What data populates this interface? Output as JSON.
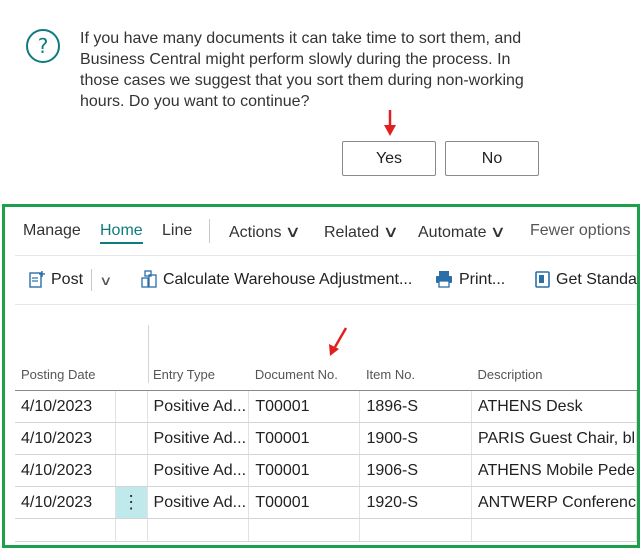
{
  "dialog": {
    "message": "If you have many documents it can take time to sort them, and Business Central might perform slowly during the process. In those cases we suggest that you sort them during non-working hours. Do you want to continue?",
    "icon": "question-icon",
    "yes_label": "Yes",
    "no_label": "No"
  },
  "menu": {
    "manage": "Manage",
    "home": "Home",
    "line": "Line",
    "actions": "Actions",
    "related": "Related",
    "automate": "Automate",
    "fewer_options": "Fewer options"
  },
  "toolbar": {
    "post": "Post",
    "calc": "Calculate Warehouse Adjustment...",
    "print": "Print...",
    "get_standard": "Get Standar"
  },
  "table": {
    "headers": [
      "Posting Date",
      "",
      "Entry Type",
      "Document No.",
      "Item No.",
      "Description"
    ],
    "rows": [
      [
        "4/10/2023",
        "",
        "Positive Ad...",
        "T00001",
        "1896-S",
        "ATHENS Desk"
      ],
      [
        "4/10/2023",
        "",
        "Positive Ad...",
        "T00001",
        "1900-S",
        "PARIS Guest Chair, bl"
      ],
      [
        "4/10/2023",
        "",
        "Positive Ad...",
        "T00001",
        "1906-S",
        "ATHENS Mobile Pede"
      ],
      [
        "4/10/2023",
        "⋮",
        "Positive Ad...",
        "T00001",
        "1920-S",
        "ANTWERP Conferenc"
      ]
    ]
  },
  "colors": {
    "accent": "#0f7b7e",
    "highlight_frame": "#1ca04b",
    "annotation_arrow": "#e02020",
    "selected_cell": "#bfe9ea"
  }
}
